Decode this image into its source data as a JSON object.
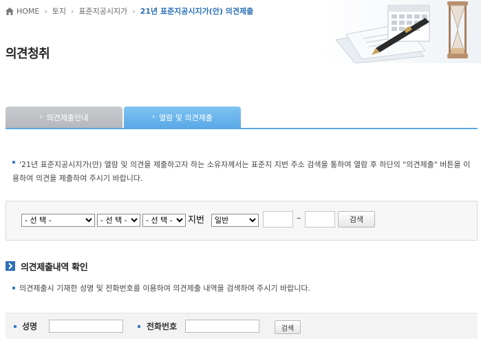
{
  "breadcrumb": {
    "home": "HOME",
    "level1": "토지",
    "level2": "표준지공시지가",
    "current": "21년 표준지공시지가(안) 의견제출"
  },
  "page": {
    "title": "의견청취"
  },
  "tabs": [
    {
      "label": "의견제출안내",
      "active": false
    },
    {
      "label": "열람 및 의견제출",
      "active": true
    }
  ],
  "notice": {
    "text": "'21년 표준지공시지가(안) 열람 및 의견을 제출하고자 하는 소유자께서는 표준지 지번 주소 검색을 통하여 열람 후 하단의 \"의견제출\" 버튼을 이용하여 의견을 제출하여 주시기 바랍니다."
  },
  "search": {
    "select1": "- 선 택 -",
    "select2": "- 선 택 -",
    "select3": "- 선 택 -",
    "jibeon_label": "지번",
    "select4": "일반",
    "dash": "–",
    "button": "검색"
  },
  "history": {
    "title": "의견제출내역 확인",
    "desc": "의견제출시 기재한 성명 및 전화번호를 이용하여 의견제출 내역을 검색하여 주시기 바랍니다.",
    "name_label": "성명",
    "phone_label": "전화번호",
    "button": "검색"
  },
  "colors": {
    "accent": "#5aa9e6",
    "link": "#2a6fb7",
    "section_icon": "#2f6fb8"
  }
}
